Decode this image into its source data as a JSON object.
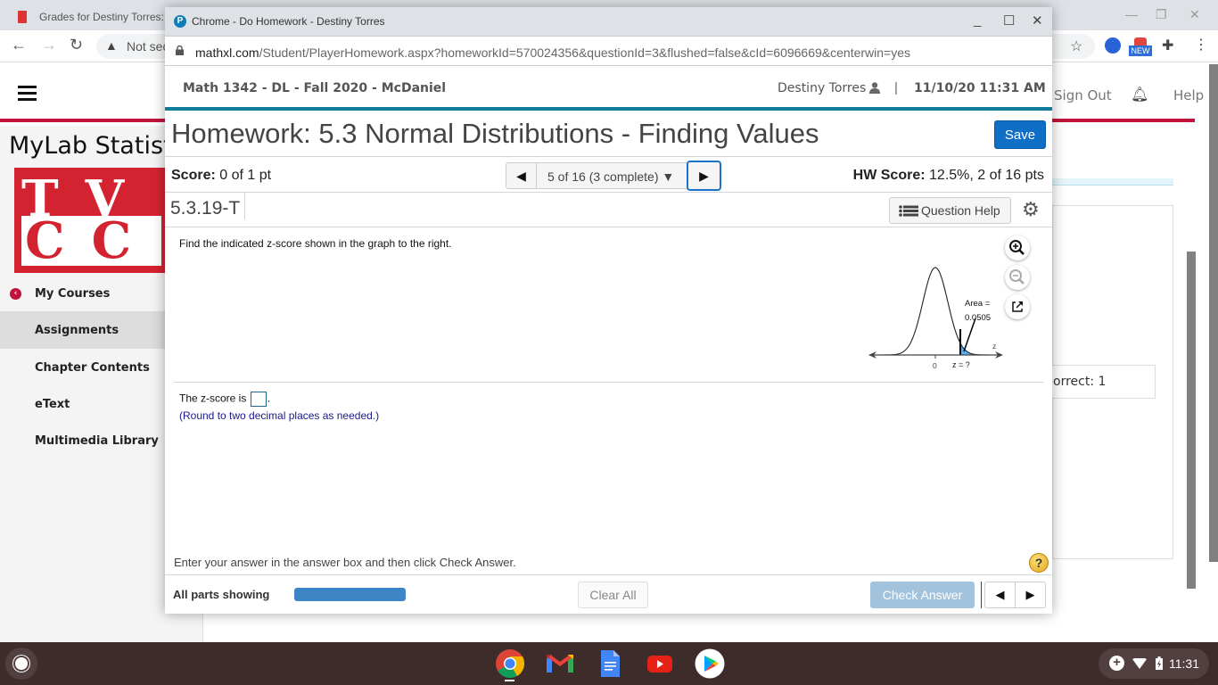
{
  "browser": {
    "tab_title": "Grades for Destiny Torres:",
    "address_warning": "Not sec",
    "extension_badge": "NEW"
  },
  "site": {
    "brand": "MyLab Statistics",
    "header_links": {
      "sign_out": "Sign Out",
      "help": "Help"
    },
    "logo_rows": [
      "TV",
      "CC"
    ],
    "sidebar": {
      "items": [
        {
          "label": "My Courses",
          "icon": "chevron-left-circle-icon"
        },
        {
          "label": "Assignments",
          "active": true
        },
        {
          "label": "Chapter Contents"
        },
        {
          "label": "eText"
        },
        {
          "label": "Multimedia Library"
        }
      ]
    },
    "right_panel_text": "orrect: 1"
  },
  "popup": {
    "window_title": "Chrome - Do Homework - Destiny Torres",
    "url_domain": "mathxl.com",
    "url_path": "/Student/PlayerHomework.aspx?homeworkId=570024356&questionId=3&flushed=false&cId=6096669&centerwin=yes",
    "course": "Math 1342 - DL - Fall 2020 - McDaniel",
    "user": "Destiny Torres",
    "separator": "|",
    "datetime": "11/10/20 11:31 AM",
    "homework_title": "Homework: 5.3 Normal Distributions - Finding Values",
    "save_label": "Save",
    "score_label": "Score:",
    "score_value": "0 of 1 pt",
    "question_selector": "5 of 16 (3 complete)",
    "hw_score_label": "HW Score:",
    "hw_score_value": "12.5%, 2 of 16 pts",
    "question_id": "5.3.19-T",
    "question_help_label": "Question Help",
    "question_text": "Find the indicated z-score shown in the graph to the right.",
    "graph": {
      "area_label": "Area =",
      "area_value": "0.0505",
      "axis_label": "z",
      "tick_zero": "0",
      "tick_z": "z = ?"
    },
    "answer_prefix": "The z-score is",
    "answer_value": "",
    "answer_suffix": ".",
    "round_note": "(Round to two decimal places as needed.)",
    "instruction": "Enter your answer in the answer box and then click Check Answer.",
    "help_icon_glyph": "?",
    "all_parts_label": "All parts showing",
    "parts_progress_percent": 100,
    "clear_all_label": "Clear All",
    "check_answer_label": "Check Answer"
  },
  "taskbar": {
    "apps": [
      "Chrome",
      "Gmail",
      "Docs",
      "YouTube",
      "Play Store"
    ],
    "time": "11:31"
  }
}
